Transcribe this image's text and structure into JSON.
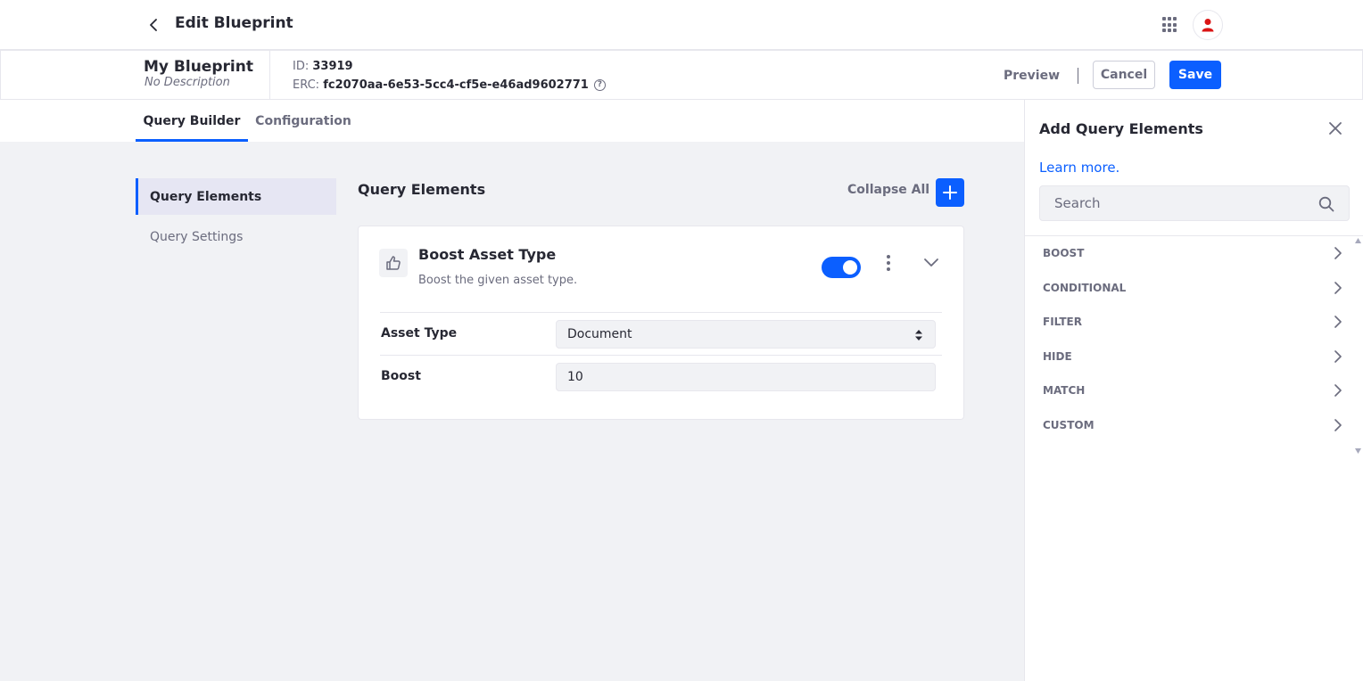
{
  "header": {
    "title": "Edit Blueprint"
  },
  "blueprint": {
    "name": "My Blueprint",
    "description": "No Description",
    "id_label": "ID:",
    "id_value": "33919",
    "erc_label": "ERC:",
    "erc_value": "fc2070aa-6e53-5cc4-cf5e-e46ad9602771"
  },
  "actions": {
    "preview": "Preview",
    "cancel": "Cancel",
    "save": "Save"
  },
  "tabs": [
    {
      "label": "Query Builder",
      "active": true
    },
    {
      "label": "Configuration",
      "active": false
    }
  ],
  "side_nav": [
    {
      "label": "Query Elements",
      "active": true
    },
    {
      "label": "Query Settings",
      "active": false
    }
  ],
  "main": {
    "title": "Query Elements",
    "collapse_all": "Collapse All",
    "element": {
      "title": "Boost Asset Type",
      "description": "Boost the given asset type.",
      "enabled": true,
      "fields": [
        {
          "label": "Asset Type",
          "value": "Document",
          "type": "select"
        },
        {
          "label": "Boost",
          "value": "10",
          "type": "input"
        }
      ]
    }
  },
  "panel": {
    "title": "Add Query Elements",
    "learn_more": "Learn more.",
    "search_placeholder": "Search",
    "categories": [
      "BOOST",
      "CONDITIONAL",
      "FILTER",
      "HIDE",
      "MATCH",
      "CUSTOM"
    ]
  },
  "icons": {
    "back": "chevron-left-icon",
    "apps": "apps-grid-icon",
    "user": "user-icon",
    "help": "question-circle-icon",
    "add": "plus-icon",
    "element": "thumbs-up-icon",
    "menu": "kebab-icon",
    "collapse": "chevron-down-icon",
    "close": "close-icon",
    "search": "search-icon",
    "category": "chevron-right-icon"
  },
  "colors": {
    "primary": "#0b5fff",
    "avatar": "#da1414"
  }
}
